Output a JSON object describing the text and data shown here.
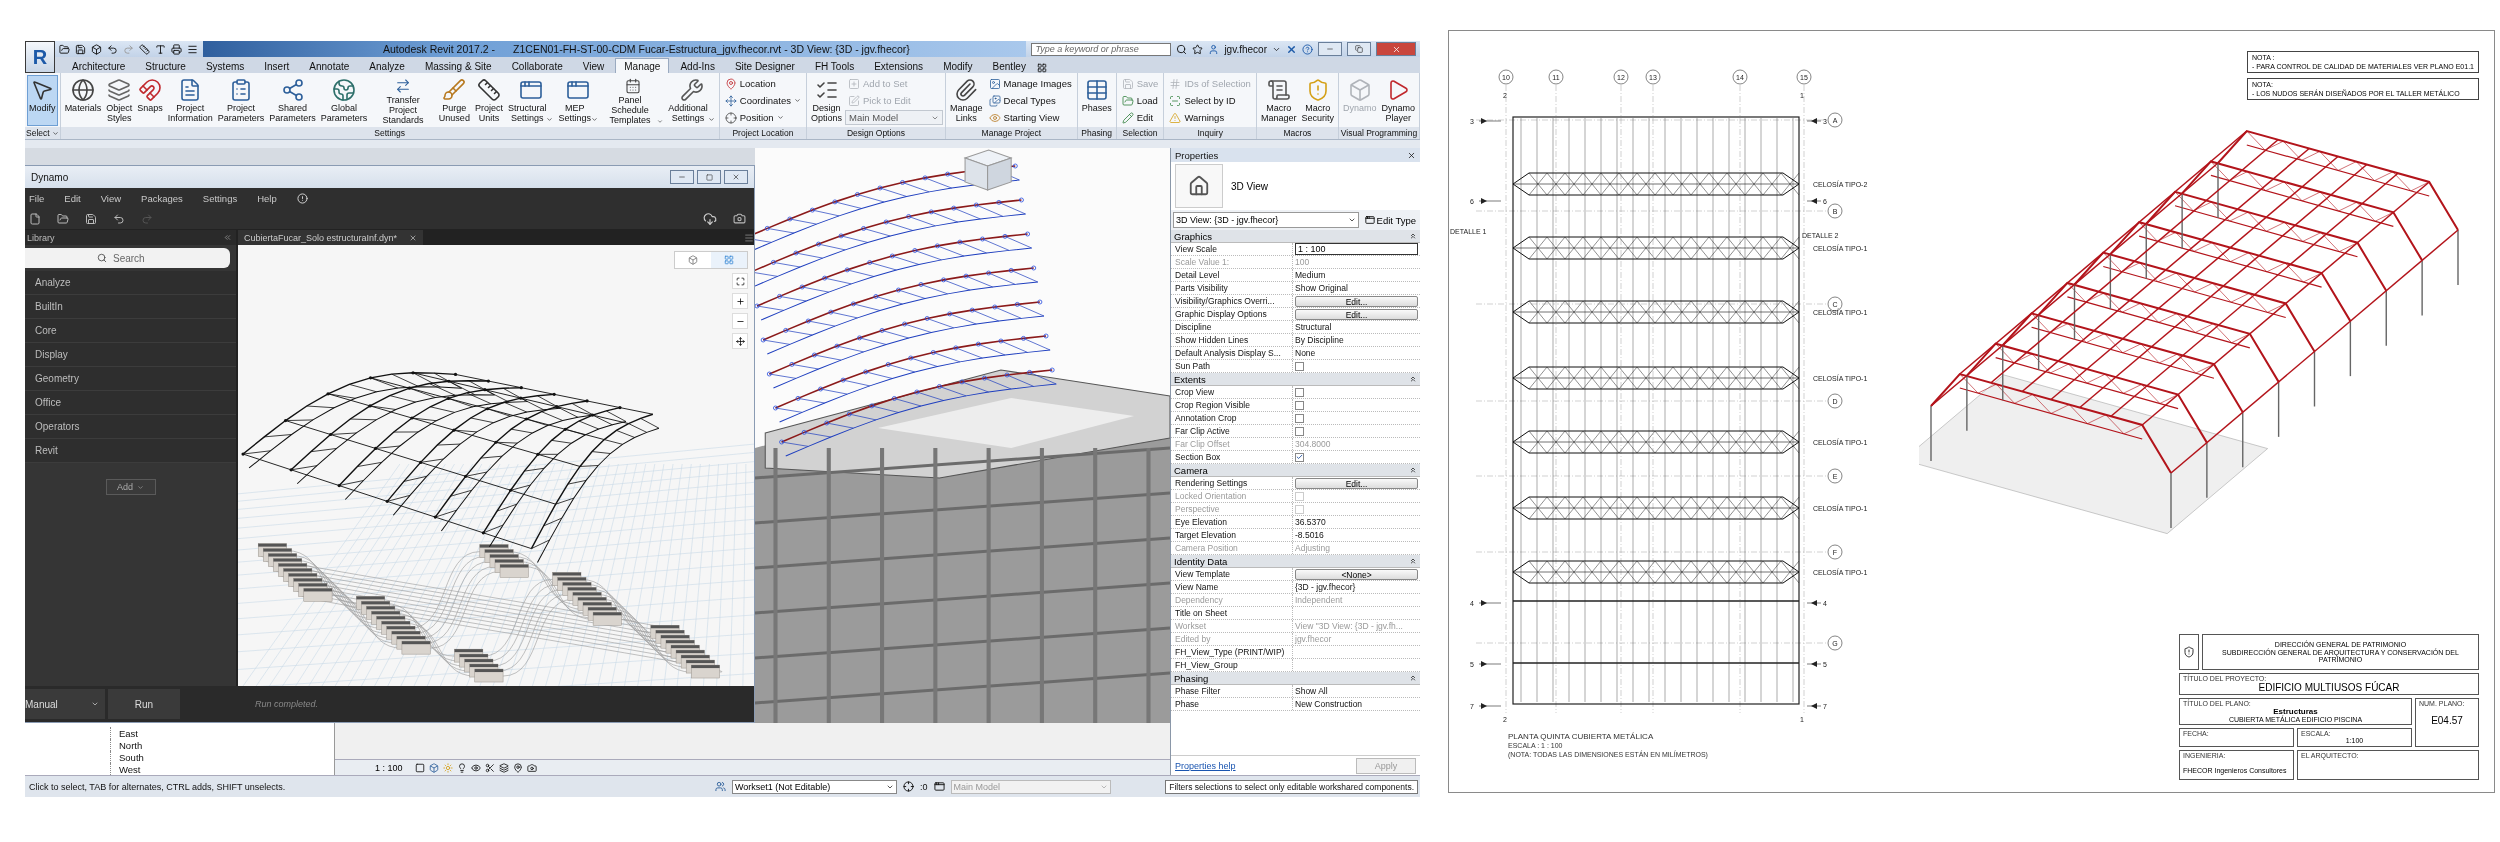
{
  "revit": {
    "app_button": "R",
    "title": "Autodesk Revit 2017.2 -",
    "document": "Z1CEN01-FH-ST-00-CDM Fucar-Estructura_jgv.fhecor.rvt - 3D View: {3D - jgv.fhecor}",
    "search": {
      "placeholder": "Type a keyword or phrase"
    },
    "user": "jgv.fhecor",
    "tabs": [
      {
        "label": "Architecture",
        "selected": false
      },
      {
        "label": "Structure",
        "selected": false
      },
      {
        "label": "Systems",
        "selected": false
      },
      {
        "label": "Insert",
        "selected": false
      },
      {
        "label": "Annotate",
        "selected": false
      },
      {
        "label": "Analyze",
        "selected": false
      },
      {
        "label": "Massing & Site",
        "selected": false
      },
      {
        "label": "Collaborate",
        "selected": false
      },
      {
        "label": "View",
        "selected": false
      },
      {
        "label": "Manage",
        "selected": true
      },
      {
        "label": "Add-Ins",
        "selected": false
      },
      {
        "label": "Site Designer",
        "selected": false
      },
      {
        "label": "FH Tools",
        "selected": false
      },
      {
        "label": "Extensions",
        "selected": false
      },
      {
        "label": "Modify",
        "selected": false
      },
      {
        "label": "Bentley",
        "selected": false
      }
    ],
    "panels": [
      {
        "title": "Select",
        "title_caret": true,
        "buttons": [
          {
            "kind": "large",
            "label": "Modify",
            "selected": true,
            "disabled": false
          }
        ]
      },
      {
        "title": "Settings",
        "buttons": [
          {
            "kind": "large",
            "label": "Materials",
            "disabled": false
          },
          {
            "kind": "large",
            "label": "Object\nStyles",
            "disabled": false
          },
          {
            "kind": "large",
            "label": "Snaps",
            "disabled": false
          },
          {
            "kind": "large",
            "label": "Project\nInformation",
            "disabled": false
          },
          {
            "kind": "large",
            "label": "Project\nParameters",
            "disabled": false
          },
          {
            "kind": "large",
            "label": "Shared\nParameters",
            "disabled": false
          },
          {
            "kind": "large",
            "label": "Global\nParameters",
            "disabled": false
          },
          {
            "kind": "large",
            "label": "Transfer\nProject Standards",
            "disabled": false
          },
          {
            "kind": "large",
            "label": "Purge\nUnused",
            "disabled": false
          },
          {
            "kind": "large",
            "label": "Project\nUnits",
            "disabled": false
          },
          {
            "kind": "large",
            "label": "Structural\nSettings",
            "caret": true,
            "disabled": false
          },
          {
            "kind": "large",
            "label": "MEP\nSettings",
            "caret": true,
            "disabled": false
          },
          {
            "kind": "large",
            "label": "Panel Schedule\nTemplates",
            "caret": true,
            "disabled": false
          },
          {
            "kind": "large",
            "label": "Additional\nSettings",
            "caret": true,
            "disabled": false
          }
        ]
      },
      {
        "title": "Project Location",
        "buttons": [
          {
            "kind": "small",
            "label": "Location",
            "disabled": false
          },
          {
            "kind": "small",
            "label": "Coordinates",
            "caret": true,
            "disabled": false
          },
          {
            "kind": "small",
            "label": "Position",
            "caret": true,
            "disabled": false
          }
        ]
      },
      {
        "title": "Design Options",
        "buttons": [
          {
            "kind": "large",
            "label": "Design\nOptions",
            "disabled": false
          },
          {
            "kind": "small",
            "label": "Add to Set",
            "disabled": true
          },
          {
            "kind": "small",
            "label": "Pick to Edit",
            "disabled": true
          },
          {
            "kind": "combo",
            "label": "Main Model",
            "disabled": false
          }
        ]
      },
      {
        "title": "Manage Project",
        "buttons": [
          {
            "kind": "large",
            "label": "Manage\nLinks",
            "disabled": false
          },
          {
            "kind": "small",
            "label": "Manage Images",
            "disabled": false
          },
          {
            "kind": "small",
            "label": "Decal Types",
            "disabled": false
          },
          {
            "kind": "small",
            "label": "Starting View",
            "disabled": false
          }
        ]
      },
      {
        "title": "Phasing",
        "buttons": [
          {
            "kind": "large",
            "label": "Phases",
            "disabled": false
          }
        ]
      },
      {
        "title": "Selection",
        "buttons": [
          {
            "kind": "small",
            "label": "Save",
            "disabled": true
          },
          {
            "kind": "small",
            "label": "Load",
            "disabled": false
          },
          {
            "kind": "small",
            "label": "Edit",
            "disabled": false
          }
        ]
      },
      {
        "title": "Inquiry",
        "buttons": [
          {
            "kind": "small",
            "label": "IDs of Selection",
            "disabled": true
          },
          {
            "kind": "small",
            "label": "Select by ID",
            "disabled": false
          },
          {
            "kind": "small",
            "label": "Warnings",
            "disabled": false
          }
        ]
      },
      {
        "title": "Macros",
        "buttons": [
          {
            "kind": "large",
            "label": "Macro\nManager",
            "disabled": false
          },
          {
            "kind": "large",
            "label": "Macro\nSecurity",
            "disabled": false
          }
        ]
      },
      {
        "title": "Visual Programming",
        "buttons": [
          {
            "kind": "large",
            "label": "Dynamo",
            "disabled": true
          },
          {
            "kind": "large",
            "label": "Dynamo\nPlayer",
            "disabled": false
          }
        ]
      }
    ],
    "dynamo": {
      "title": "Dynamo",
      "menu": [
        "File",
        "Edit",
        "View",
        "Packages",
        "Settings",
        "Help"
      ],
      "library_title": "Library",
      "search": {
        "placeholder": "Search"
      },
      "categories": [
        "Analyze",
        "BuiltIn",
        "Core",
        "Display",
        "Geometry",
        "Office",
        "Operators",
        "Revit"
      ],
      "add_button": "Add",
      "canvas_views": [
        {
          "kind": "geometry",
          "selected": false
        },
        {
          "kind": "graph",
          "selected": true
        }
      ],
      "tab": "CubiertaFucar_Solo estructuraInf.dyn*",
      "run_mode": "Manual",
      "run_button": "Run",
      "run_status": "Run completed."
    },
    "browser_items": [
      "East",
      "North",
      "South",
      "West"
    ],
    "view_scale": "1 : 100",
    "properties": {
      "title": "Properties",
      "type": "3D View",
      "instance": "3D View: {3D - jgv.fhecor}",
      "edit_type": "Edit Type",
      "groups": [
        {
          "name": "Graphics",
          "rows": [
            {
              "label": "View Scale",
              "value": "1 : 100",
              "kind": "field",
              "disabled": false
            },
            {
              "label": "Scale Value    1:",
              "value": "100",
              "kind": "text",
              "disabled": true
            },
            {
              "label": "Detail Level",
              "value": "Medium",
              "kind": "text",
              "disabled": false
            },
            {
              "label": "Parts Visibility",
              "value": "Show Original",
              "kind": "text",
              "disabled": false
            },
            {
              "label": "Visibility/Graphics Overri...",
              "value": "Edit...",
              "kind": "button",
              "disabled": false
            },
            {
              "label": "Graphic Display Options",
              "value": "Edit...",
              "kind": "button",
              "disabled": false
            },
            {
              "label": "Discipline",
              "value": "Structural",
              "kind": "text",
              "disabled": false
            },
            {
              "label": "Show Hidden Lines",
              "value": "By Discipline",
              "kind": "text",
              "disabled": false
            },
            {
              "label": "Default Analysis Display S...",
              "value": "None",
              "kind": "text",
              "disabled": false
            },
            {
              "label": "Sun Path",
              "kind": "checkbox",
              "checked": false,
              "disabled": false
            }
          ]
        },
        {
          "name": "Extents",
          "rows": [
            {
              "label": "Crop View",
              "kind": "checkbox",
              "checked": false,
              "disabled": false
            },
            {
              "label": "Crop Region Visible",
              "kind": "checkbox",
              "checked": false,
              "disabled": false
            },
            {
              "label": "Annotation Crop",
              "kind": "checkbox",
              "checked": false,
              "disabled": false
            },
            {
              "label": "Far Clip Active",
              "kind": "checkbox",
              "checked": false,
              "disabled": false
            },
            {
              "label": "Far Clip Offset",
              "value": "304.8000",
              "kind": "text",
              "disabled": true
            },
            {
              "label": "Section Box",
              "kind": "checkbox",
              "checked": true,
              "disabled": false
            }
          ]
        },
        {
          "name": "Camera",
          "rows": [
            {
              "label": "Rendering Settings",
              "value": "Edit...",
              "kind": "button",
              "disabled": false
            },
            {
              "label": "Locked Orientation",
              "kind": "checkbox",
              "checked": false,
              "disabled": true
            },
            {
              "label": "Perspective",
              "kind": "checkbox",
              "checked": false,
              "disabled": true
            },
            {
              "label": "Eye Elevation",
              "value": "36.5370",
              "kind": "text",
              "disabled": false
            },
            {
              "label": "Target Elevation",
              "value": "-8.5016",
              "kind": "text",
              "disabled": false
            },
            {
              "label": "Camera Position",
              "value": "Adjusting",
              "kind": "text",
              "disabled": true
            }
          ]
        },
        {
          "name": "Identity Data",
          "rows": [
            {
              "label": "View Template",
              "value": "<None>",
              "kind": "button",
              "disabled": false
            },
            {
              "label": "View Name",
              "value": "{3D - jgv.fhecor}",
              "kind": "text",
              "disabled": false
            },
            {
              "label": "Dependency",
              "value": "Independent",
              "kind": "text",
              "disabled": true
            },
            {
              "label": "Title on Sheet",
              "kind": "text",
              "disabled": false
            },
            {
              "label": "Workset",
              "value": "View \"3D View: {3D - jgv.fh...",
              "kind": "text",
              "disabled": true
            },
            {
              "label": "Edited by",
              "value": "jgv.fhecor",
              "kind": "text",
              "disabled": true
            },
            {
              "label": "FH_View_Type (PRINT/WIP)",
              "kind": "text",
              "disabled": false
            },
            {
              "label": "FH_View_Group",
              "kind": "text",
              "disabled": false
            }
          ]
        },
        {
          "name": "Phasing",
          "rows": [
            {
              "label": "Phase Filter",
              "value": "Show All",
              "kind": "text",
              "disabled": false
            },
            {
              "label": "Phase",
              "value": "New Construction",
              "kind": "text",
              "disabled": false
            }
          ]
        }
      ],
      "help": "Properties help",
      "apply": "Apply"
    },
    "status_bar": {
      "hint": "Click to select, TAB for alternates, CTRL adds, SHIFT unselects.",
      "workset": "Workset1 (Not Editable)",
      "count": ":0",
      "model": "Main Model",
      "tooltip": "Filters selections to select only editable workshared components."
    }
  },
  "sheet": {
    "plan": {
      "column_grid": [
        "10",
        "11",
        "12",
        "13",
        "14",
        "15"
      ],
      "row_grid": [
        "A",
        "B",
        "C",
        "D",
        "E",
        "F",
        "G"
      ],
      "left_marks": [
        "3",
        "6",
        "4",
        "5",
        "7"
      ],
      "right_marks": [
        "3",
        "6",
        "4",
        "5",
        "7"
      ],
      "top_cut_marks": [
        "2",
        "1"
      ],
      "bottom_cut_marks": [
        "2",
        "1"
      ],
      "truss_labels": [
        "CELOSÍA TIPO-2",
        "CELOSÍA TIPO-1",
        "CELOSÍA TIPO-1",
        "CELOSÍA TIPO-1",
        "CELOSÍA TIPO-1",
        "CELOSÍA TIPO-1",
        "CELOSÍA TIPO-1"
      ],
      "detail_labels": [
        "DETALLE 1",
        "DETALLE 2"
      ],
      "title": "PLANTA QUINTA CUBIERTA METÁLICA",
      "scale": "ESCALA : 1 : 100",
      "note": "(NOTA: TODAS LAS DIMENSIONES ESTÁN EN MILÍMETROS)"
    },
    "notes": [
      {
        "heading": "NOTA :",
        "text": "- PARA CONTROL DE CALIDAD DE MATERIALES VER PLANO E01.1"
      },
      {
        "heading": "NOTA:",
        "text": "- LOS NUDOS SERÁN DISEÑADOS POR EL TALLER METÁLICO"
      }
    ],
    "title_block": {
      "authority": "DIRECCIÓN GENERAL DE PATRIMONIO",
      "department": "SUBDIRECCIÓN GENERAL DE ARQUITECTURA Y CONSERVACIÓN DEL PATRIMONIO",
      "project_label": "TÍTULO DEL PROYECTO:",
      "project": "EDIFICIO MULTIUSOS FÚCAR",
      "drawing_label": "TÍTULO DEL PLANO:",
      "drawing": "Estructuras",
      "drawing_subtitle": "CUBIERTA METÁLICA EDIFICIO PISCINA",
      "number_label": "NUM. PLANO:",
      "number": "E04.57",
      "date_label": "FECHA:",
      "scale_label": "ESCALA:",
      "scale": "1:100",
      "engineering_label": "INGENIERIA:",
      "engineering": "FHECOR Ingenieros Consultores",
      "architect_label": "EL ARQUITECTO:"
    }
  }
}
